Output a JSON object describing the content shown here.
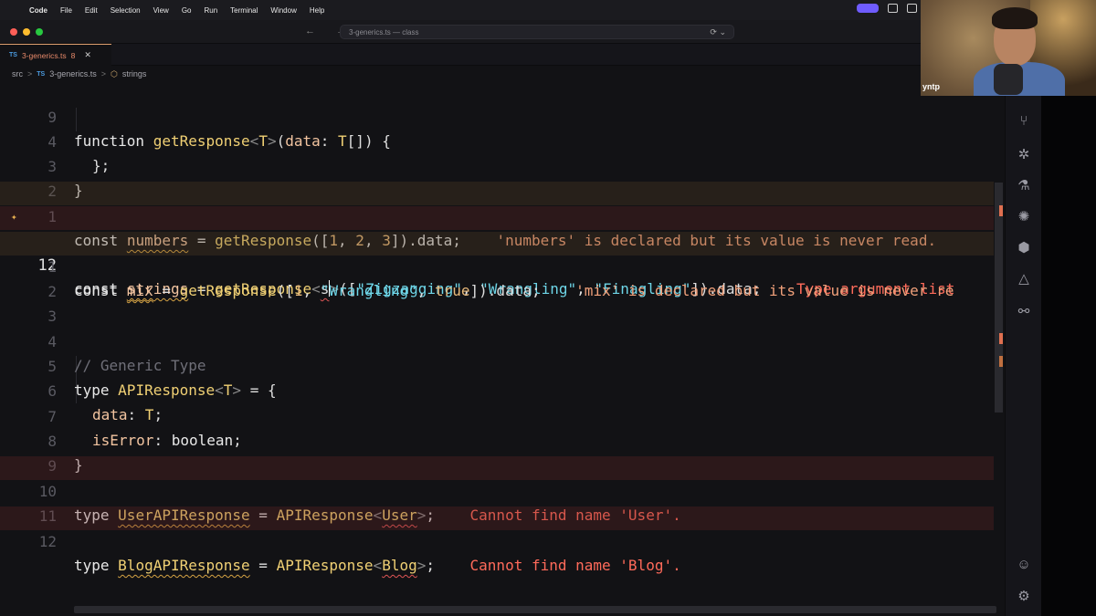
{
  "menubar": {
    "apple": "",
    "items": [
      "Code",
      "File",
      "Edit",
      "Selection",
      "View",
      "Go",
      "Run",
      "Terminal",
      "Window",
      "Help"
    ]
  },
  "titlebar": {
    "nav_arrows": "← →",
    "command_center": "3-generics.ts — class",
    "ai_icon": "⟳ ⌄"
  },
  "tab": {
    "lang": "TS",
    "name": "3-generics.ts",
    "problems": "8",
    "close": "✕"
  },
  "breadcrumb": {
    "folder": "src",
    "sep": ">",
    "lang": "TS",
    "file": "3-generics.ts",
    "symbol": "strings"
  },
  "editor": {
    "lines": [
      {
        "ln": "9",
        "kind": "fn_decl"
      },
      {
        "ln": "4",
        "kind": "close_obj"
      },
      {
        "ln": "3",
        "kind": "close_brace"
      },
      {
        "ln": "2",
        "kind": "blank"
      },
      {
        "ln": "1",
        "kind": "numbers",
        "diag": "'numbers' is declared but its value is never read."
      },
      {
        "ln": "12",
        "kind": "strings",
        "diag": "Type argument list"
      },
      {
        "ln": "1",
        "kind": "mix",
        "diag": "'mix' is declared but its value is never re"
      },
      {
        "ln": "2",
        "kind": "blank"
      },
      {
        "ln": "3",
        "kind": "blank"
      },
      {
        "ln": "4",
        "kind": "comment",
        "text": "// Generic Type"
      },
      {
        "ln": "5",
        "kind": "type_decl"
      },
      {
        "ln": "6",
        "kind": "prop_data"
      },
      {
        "ln": "7",
        "kind": "prop_iserror"
      },
      {
        "ln": "8",
        "kind": "close_brace"
      },
      {
        "ln": "9",
        "kind": "blank"
      },
      {
        "ln": "10",
        "kind": "user_type",
        "diag": "Cannot find name 'User'."
      },
      {
        "ln": "11",
        "kind": "blank"
      },
      {
        "ln": "12",
        "kind": "blog_type",
        "diag": "Cannot find name 'Blog'."
      }
    ],
    "tokens": {
      "function": "function",
      "getResponse": "getResponse",
      "T": "T",
      "data": "data",
      "const": "const",
      "numbers": "numbers",
      "strings": "strings",
      "mix": "mix",
      "s": "s",
      "str1": "\"Zigzagging\"",
      "str2": "\"Wrangling\"",
      "str3": "\"Finagling\"",
      "n1": "1",
      "n2": "2",
      "n3": "3",
      "true": "true",
      "type": "type",
      "APIResponse": "APIResponse",
      "isError": "isError",
      "boolean": "boolean",
      "UserAPIResponse": "UserAPIResponse",
      "User": "User",
      "BlogAPIResponse": "BlogAPIResponse",
      "Blog": "Blog",
      "dotdata": ".data;"
    }
  },
  "webcam": {
    "caption": "yntp"
  },
  "colors": {
    "accent": "#6f5cff",
    "error": "#ff6a5a",
    "warning": "#f0a07a",
    "string": "#6ed6e8",
    "function": "#f0d074"
  },
  "activity_icons": [
    "source-control-icon",
    "extensions-icon",
    "testing-icon",
    "debug-icon",
    "package-icon",
    "triangle-icon",
    "link-icon",
    "account-icon",
    "settings-gear-icon"
  ]
}
